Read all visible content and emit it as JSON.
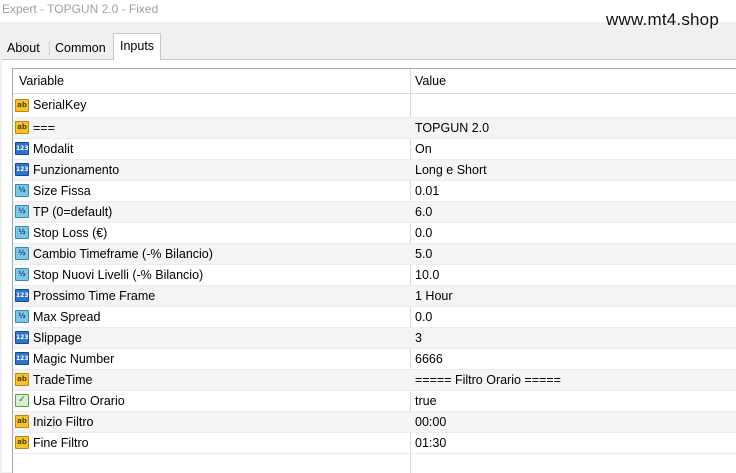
{
  "window": {
    "title": "Expert - TOPGUN 2.0 - Fixed",
    "watermark": "www.mt4.shop"
  },
  "tabs": [
    {
      "label": "About",
      "active": false
    },
    {
      "label": "Common",
      "active": false
    },
    {
      "label": "Inputs",
      "active": true
    }
  ],
  "table": {
    "headers": {
      "variable": "Variable",
      "value": "Value"
    },
    "rows": [
      {
        "name": "SerialKey",
        "value": "",
        "icon": "string-icon"
      },
      {
        "name": "===",
        "value": "TOPGUN 2.0",
        "icon": "string-icon"
      },
      {
        "name": "Modalit",
        "value": "On",
        "icon": "integer-icon"
      },
      {
        "name": "Funzionamento",
        "value": "Long e Short",
        "icon": "integer-icon"
      },
      {
        "name": "Size Fissa",
        "value": "0.01",
        "icon": "double-icon"
      },
      {
        "name": "TP  (0=default)",
        "value": "6.0",
        "icon": "double-icon"
      },
      {
        "name": "Stop Loss (€)",
        "value": "0.0",
        "icon": "double-icon"
      },
      {
        "name": "Cambio Timeframe (-% Bilancio)",
        "value": "5.0",
        "icon": "double-icon"
      },
      {
        "name": "Stop Nuovi Livelli (-% Bilancio)",
        "value": "10.0",
        "icon": "double-icon"
      },
      {
        "name": "Prossimo Time Frame",
        "value": "1 Hour",
        "icon": "integer-icon"
      },
      {
        "name": "Max Spread",
        "value": "0.0",
        "icon": "double-icon"
      },
      {
        "name": "Slippage",
        "value": "3",
        "icon": "integer-icon"
      },
      {
        "name": "Magic Number",
        "value": "6666",
        "icon": "integer-icon"
      },
      {
        "name": "TradeTime",
        "value": "===== Filtro Orario =====",
        "icon": "string-icon"
      },
      {
        "name": "Usa Filtro Orario",
        "value": "true",
        "icon": "boolean-icon"
      },
      {
        "name": "Inizio Filtro",
        "value": "00:00",
        "icon": "string-icon"
      },
      {
        "name": "Fine Filtro",
        "value": "01:30",
        "icon": "string-icon"
      }
    ]
  },
  "icon_glyphs": {
    "string-icon": "ab",
    "integer-icon": "123",
    "double-icon": "½",
    "boolean-icon": "✓"
  },
  "colors": {
    "string_icon": "#f2c230",
    "integer_icon": "#2f74c8",
    "double_icon": "#7ec6e6",
    "boolean_icon": "#5aa04a",
    "alt_row": "#f4f4f4"
  }
}
